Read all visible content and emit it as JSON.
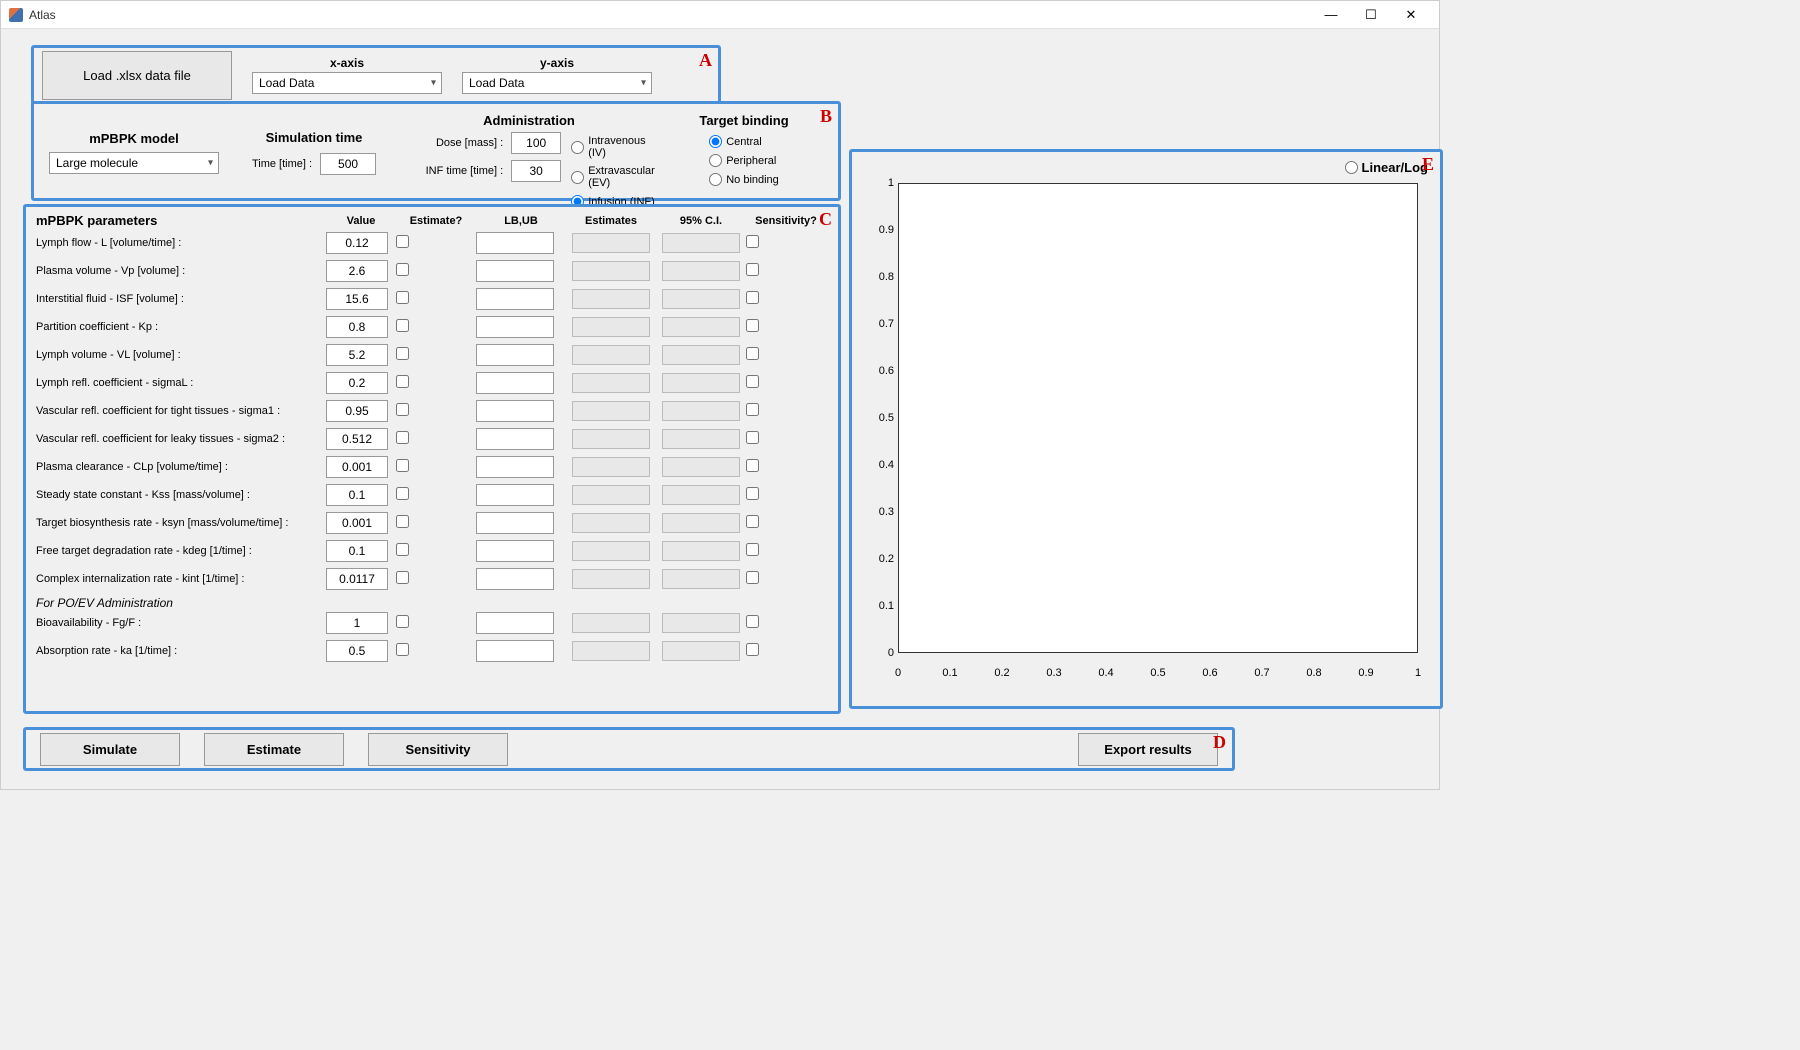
{
  "window": {
    "title": "Atlas"
  },
  "panelLabels": {
    "A": "A",
    "B": "B",
    "C": "C",
    "D": "D",
    "E": "E"
  },
  "panelA": {
    "loadBtn": "Load .xlsx data file",
    "xaxisLabel": "x-axis",
    "yaxisLabel": "y-axis",
    "xaxisValue": "Load Data",
    "yaxisValue": "Load Data"
  },
  "panelB": {
    "modelTitle": "mPBPK model",
    "modelValue": "Large molecule",
    "simTimeTitle": "Simulation time",
    "timeLabel": "Time [time] :",
    "timeValue": "500",
    "adminTitle": "Administration",
    "doseLabel": "Dose [mass] :",
    "doseValue": "100",
    "infLabel": "INF time [time] :",
    "infValue": "30",
    "adminOptions": [
      "Intravenous (IV)",
      "Extravascular (EV)",
      "Infusion (INF)"
    ],
    "adminSelected": 2,
    "targetTitle": "Target binding",
    "targetOptions": [
      "Central",
      "Peripheral",
      "No binding"
    ],
    "targetSelected": 0
  },
  "panelC": {
    "title": "mPBPK parameters",
    "headers": [
      "Value",
      "Estimate?",
      "LB,UB",
      "Estimates",
      "95% C.I.",
      "Sensitivity?"
    ],
    "rows": [
      {
        "name": "Lymph flow - L [volume/time] :",
        "value": "0.12"
      },
      {
        "name": "Plasma volume - Vp [volume] :",
        "value": "2.6"
      },
      {
        "name": "Interstitial fluid - ISF [volume] :",
        "value": "15.6"
      },
      {
        "name": "Partition coefficient - Kp :",
        "value": "0.8"
      },
      {
        "name": "Lymph volume - VL [volume] :",
        "value": "5.2"
      },
      {
        "name": "Lymph refl. coefficient - sigmaL :",
        "value": "0.2"
      },
      {
        "name": "Vascular refl. coefficient for tight tissues - sigma1 :",
        "value": "0.95"
      },
      {
        "name": "Vascular refl. coefficient for leaky tissues - sigma2 :",
        "value": "0.512"
      },
      {
        "name": "Plasma clearance - CLp [volume/time] :",
        "value": "0.001"
      },
      {
        "name": "Steady state constant - Kss [mass/volume] :",
        "value": "0.1"
      },
      {
        "name": "Target biosynthesis rate - ksyn [mass/volume/time] :",
        "value": "0.001"
      },
      {
        "name": "Free target degradation rate - kdeg [1/time] :",
        "value": "0.1"
      },
      {
        "name": "Complex internalization rate - kint [1/time] :",
        "value": "0.0117"
      }
    ],
    "subhead": "For PO/EV Administration",
    "rows2": [
      {
        "name": "Bioavailability - Fg/F :",
        "value": "1"
      },
      {
        "name": "Absorption rate - ka [1/time] :",
        "value": "0.5"
      }
    ]
  },
  "panelD": {
    "simulate": "Simulate",
    "estimate": "Estimate",
    "sensitivity": "Sensitivity",
    "export": "Export results"
  },
  "panelE": {
    "toggle": "Linear/Log",
    "yticks": [
      "1",
      "0.9",
      "0.8",
      "0.7",
      "0.6",
      "0.5",
      "0.4",
      "0.3",
      "0.2",
      "0.1",
      "0"
    ],
    "xticks": [
      "0",
      "0.1",
      "0.2",
      "0.3",
      "0.4",
      "0.5",
      "0.6",
      "0.7",
      "0.8",
      "0.9",
      "1"
    ]
  },
  "chart_data": {
    "type": "line",
    "title": "",
    "xlabel": "",
    "ylabel": "",
    "xlim": [
      0,
      1
    ],
    "ylim": [
      0,
      1
    ],
    "series": []
  }
}
